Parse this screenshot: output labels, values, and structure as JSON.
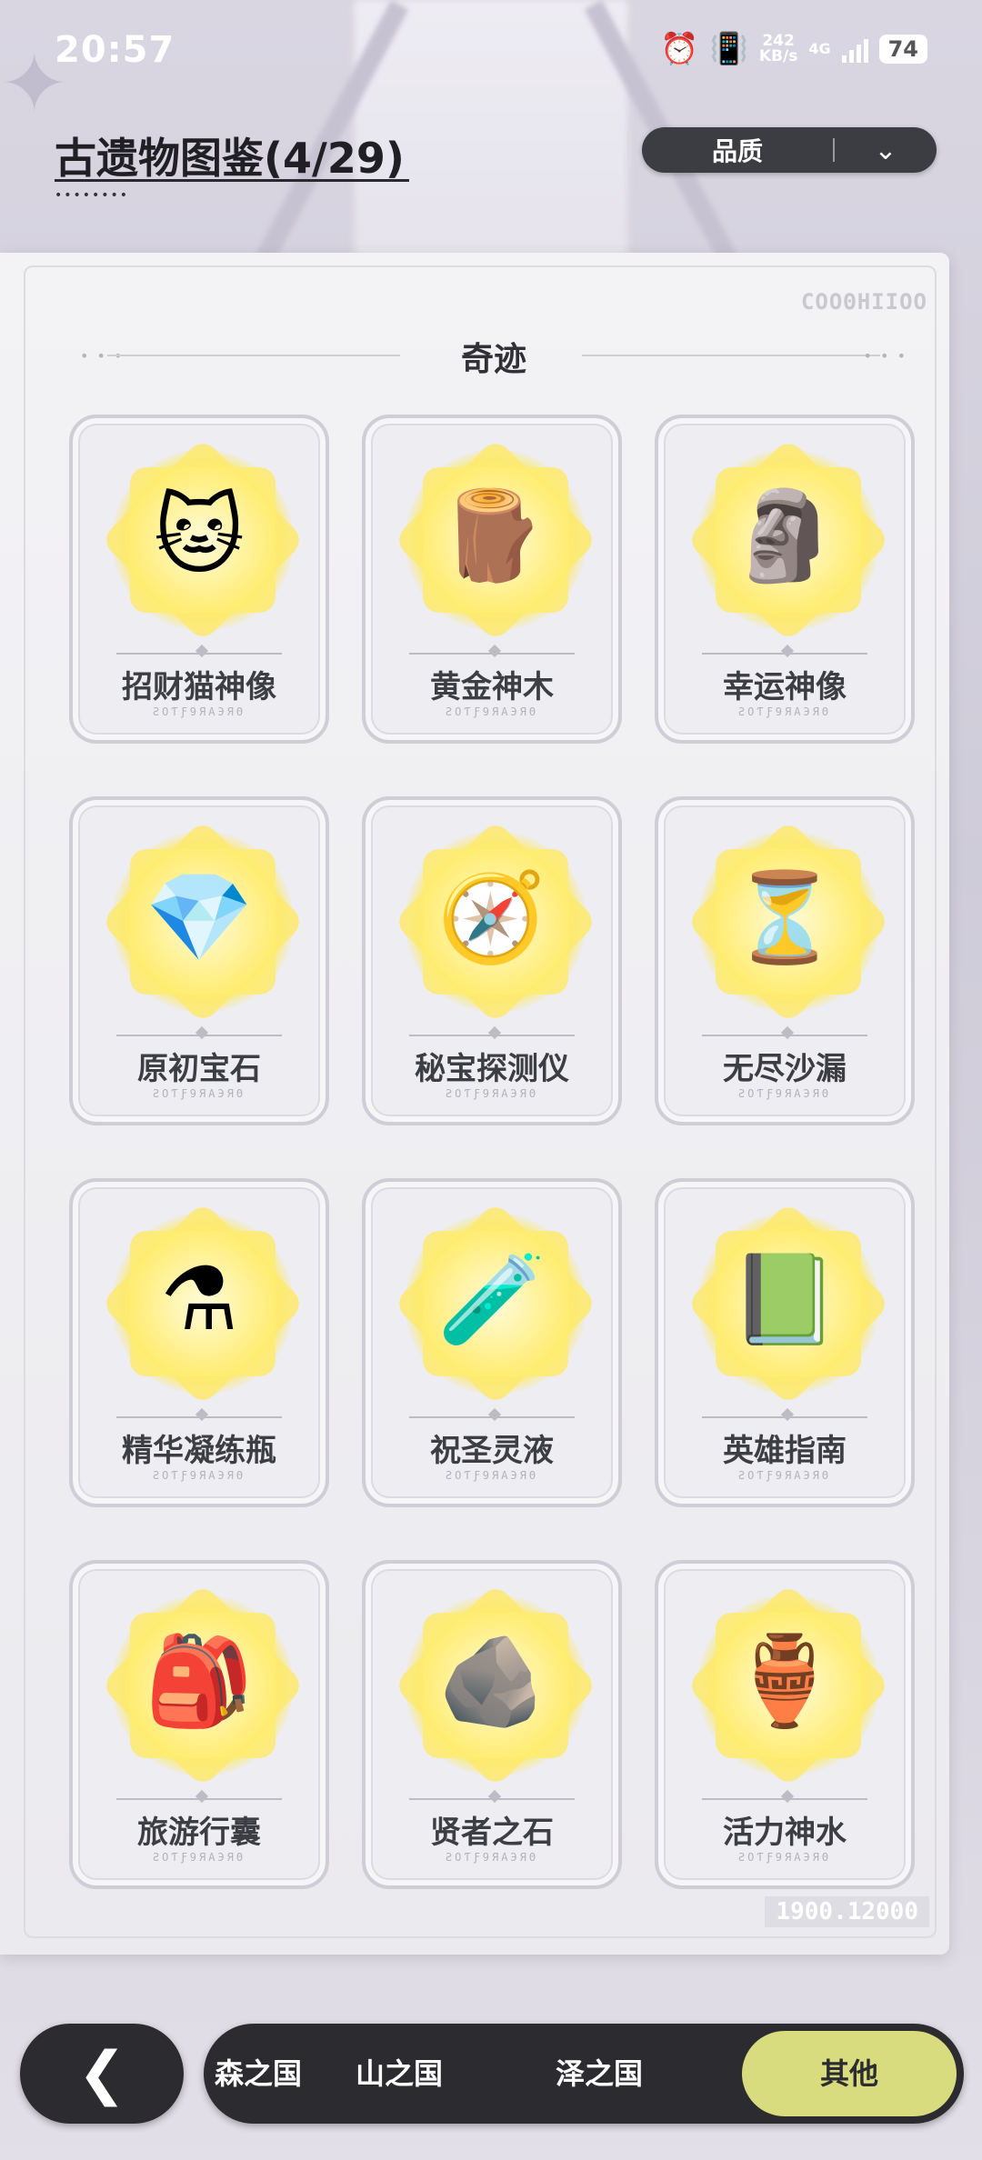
{
  "status_bar": {
    "time": "20:57",
    "speed_value": "242",
    "speed_unit": "KB/s",
    "network": "4G",
    "battery": "74"
  },
  "header": {
    "title": "古遗物图鉴(4/29)",
    "filter_label": "品质"
  },
  "panel": {
    "serial_top": "COOΘHIIOO",
    "serial_bottom": "1900.12000",
    "section_title": "奇迹"
  },
  "items": [
    {
      "name": "招财猫神像",
      "icon": "lucky-cat-statue-icon",
      "glyph": "🐱"
    },
    {
      "name": "黄金神木",
      "icon": "golden-wood-icon",
      "glyph": "🪵"
    },
    {
      "name": "幸运神像",
      "icon": "winged-statue-icon",
      "glyph": "🗿"
    },
    {
      "name": "原初宝石",
      "icon": "crystal-gem-icon",
      "glyph": "💎"
    },
    {
      "name": "秘宝探测仪",
      "icon": "pocket-watch-icon",
      "glyph": "🧭"
    },
    {
      "name": "无尽沙漏",
      "icon": "hourglass-icon",
      "glyph": "⏳"
    },
    {
      "name": "精华凝练瓶",
      "icon": "potion-bottle-icon",
      "glyph": "⚗"
    },
    {
      "name": "祝圣灵液",
      "icon": "holy-liquid-icon",
      "glyph": "🧪"
    },
    {
      "name": "英雄指南",
      "icon": "hero-book-icon",
      "glyph": "📗"
    },
    {
      "name": "旅游行囊",
      "icon": "backpack-icon",
      "glyph": "🎒"
    },
    {
      "name": "贤者之石",
      "icon": "stone-tablet-icon",
      "glyph": "🪨"
    },
    {
      "name": "活力神水",
      "icon": "vitality-vase-icon",
      "glyph": "🏺"
    }
  ],
  "item_code": "ƧOƬƑ9ЯAЭЯΘ",
  "bottom_nav": {
    "tabs": [
      "森之国",
      "山之国",
      "泽之国",
      "其他"
    ],
    "active": "其他"
  }
}
